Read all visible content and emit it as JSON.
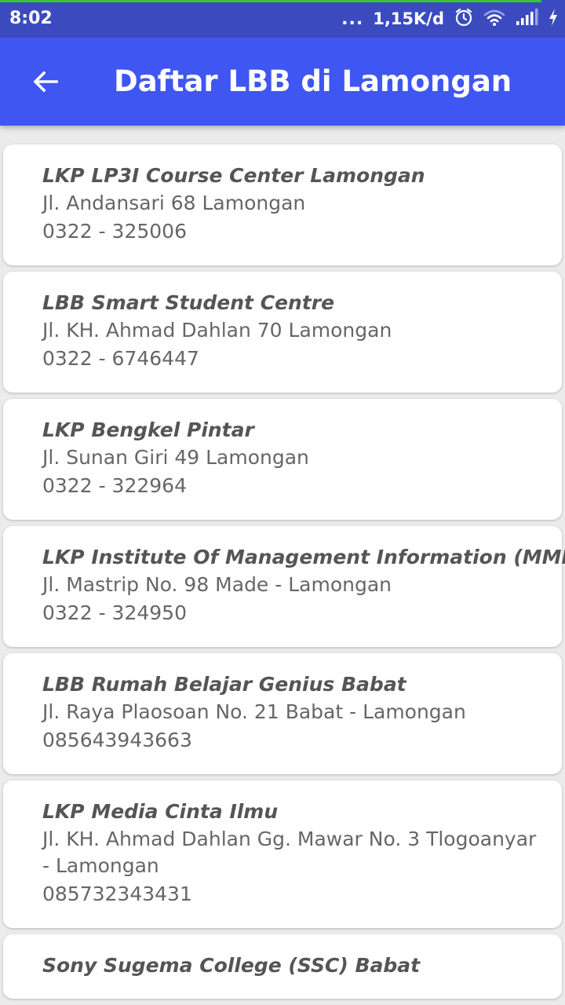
{
  "status_bar": {
    "time": "8:02",
    "dots": "...",
    "speed": "1,15K/d",
    "icons": [
      "alarm-icon",
      "wifi-icon",
      "signal-icon",
      "charging-icon"
    ]
  },
  "app_bar": {
    "back_icon": "arrow-left-icon",
    "title": "Daftar LBB di Lamongan",
    "color": "#3f56f2"
  },
  "items": [
    {
      "name": "LKP LP3I Course Center Lamongan",
      "address": "Jl. Andansari 68 Lamongan",
      "phone": "0322 - 325006"
    },
    {
      "name": "LBB Smart Student Centre",
      "address": "Jl. KH. Ahmad Dahlan 70 Lamongan",
      "phone": "0322 - 6746447"
    },
    {
      "name": "LKP Bengkel Pintar",
      "address": "Jl. Sunan Giri 49 Lamongan",
      "phone": "0322 - 322964"
    },
    {
      "name": "LKP Institute Of Management Information (MMI)",
      "address": "Jl. Mastrip No. 98 Made - Lamongan",
      "phone": "0322 - 324950"
    },
    {
      "name": "LBB Rumah Belajar Genius Babat",
      "address": "Jl. Raya Plaosoan No. 21 Babat - Lamongan",
      "phone": "085643943663"
    },
    {
      "name": "LKP Media Cinta Ilmu",
      "address": "Jl. KH. Ahmad Dahlan Gg. Mawar No. 3 Tlogoanyar - Lamongan",
      "phone": "085732343431"
    },
    {
      "name": "Sony Sugema College (SSC) Babat",
      "address": "",
      "phone": ""
    }
  ]
}
